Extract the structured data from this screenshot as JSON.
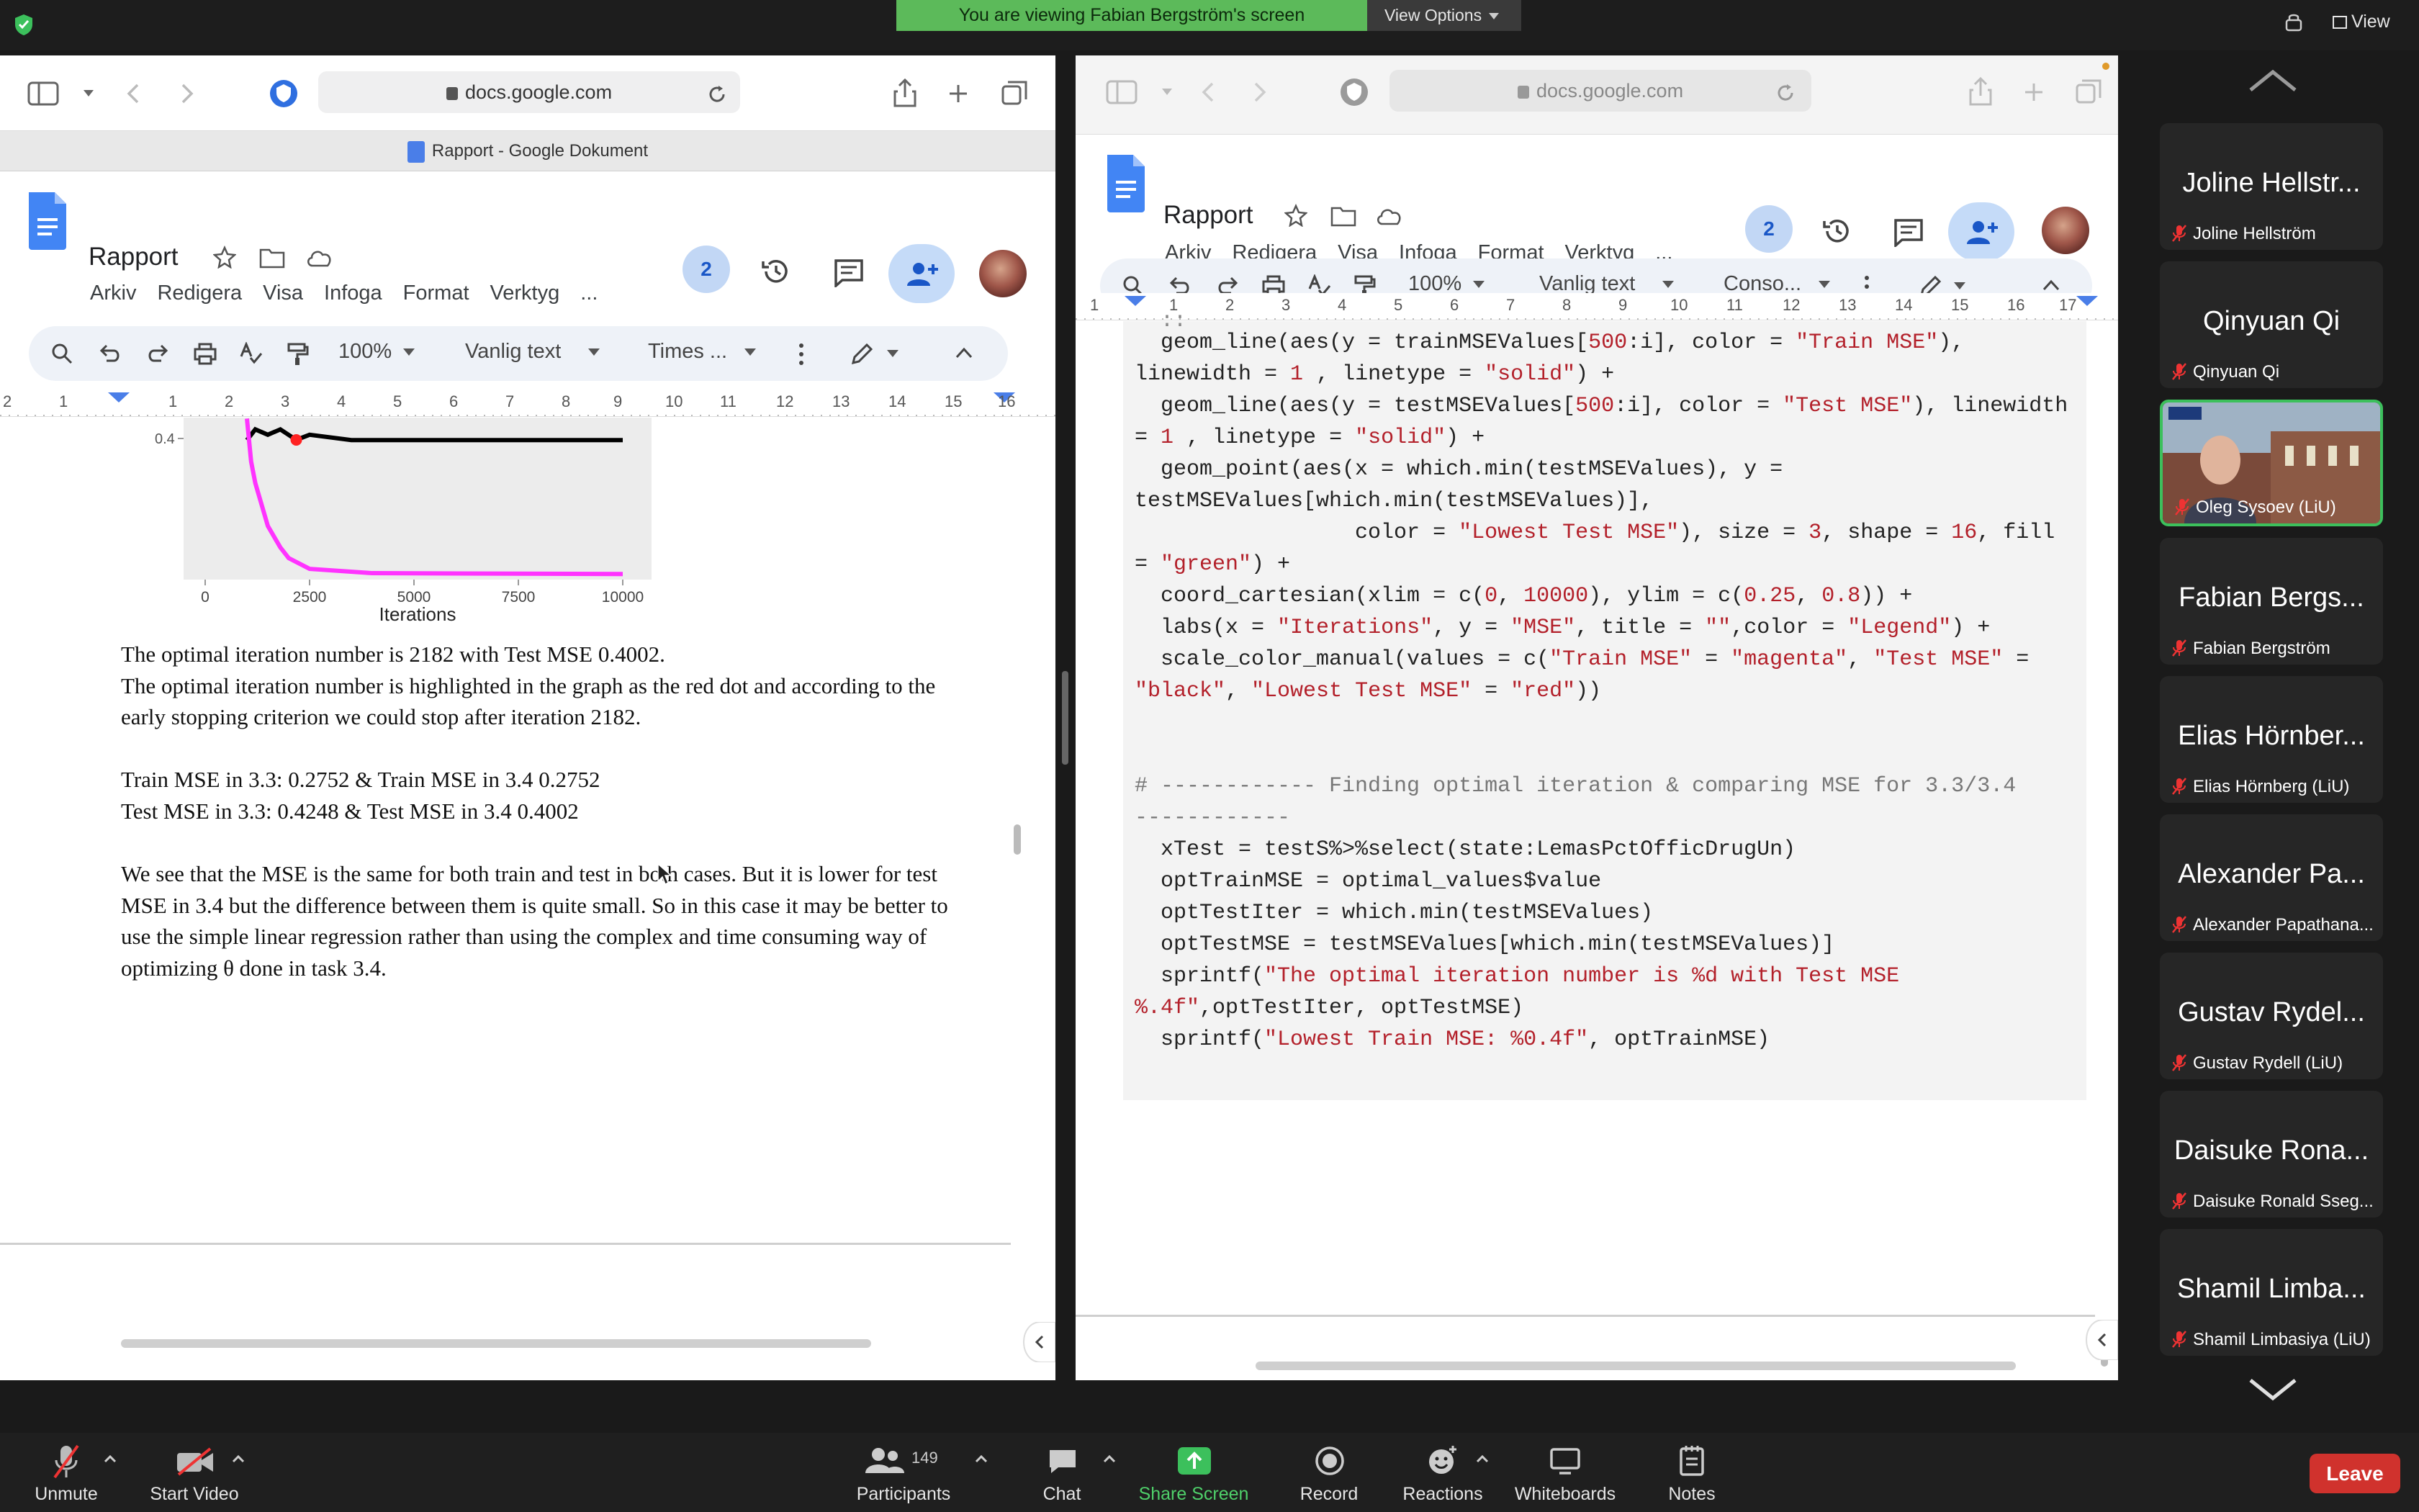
{
  "zoom_banner": {
    "text": "You are viewing Fabian Bergström's screen",
    "view_options": "View Options",
    "view_label": "View"
  },
  "left_browser": {
    "url": "docs.google.com",
    "tab_title": "Rapport - Google Dokument",
    "doc_title": "Rapport",
    "menus": [
      "Arkiv",
      "Redigera",
      "Visa",
      "Infoga",
      "Format",
      "Verktyg",
      "..."
    ],
    "badge": "2",
    "toolbar": {
      "zoom": "100%",
      "style": "Vanlig text",
      "font": "Times ..."
    },
    "ruler": [
      "2",
      "1",
      "1",
      "2",
      "3",
      "4",
      "5",
      "6",
      "7",
      "8",
      "9",
      "10",
      "11",
      "12",
      "13",
      "14",
      "15",
      "16"
    ],
    "chart": {
      "y_tick": "0.4",
      "x_ticks": [
        "0",
        "2500",
        "5000",
        "7500",
        "10000"
      ],
      "xlabel": "Iterations"
    },
    "paragraphs": [
      "The optimal iteration number is 2182 with Test MSE 0.4002.",
      "The optimal iteration number is highlighted in the graph as the red dot and according to the",
      "early stopping criterion we could stop after iteration 2182.",
      "Train MSE in 3.3: 0.2752 & Train MSE in 3.4 0.2752",
      "Test MSE in 3.3: 0.4248 & Test MSE in 3.4 0.4002",
      "We see that the MSE is the same for both train and test in both cases. But it is lower for test",
      "MSE in 3.4 but the difference between them is quite small. So in this case it may be better to",
      "use the simple linear regression rather than using the complex and time consuming way of",
      "optimizing θ done in task 3.4."
    ]
  },
  "right_browser": {
    "url": "docs.google.com",
    "doc_title": "Rapport",
    "menus": [
      "Arkiv",
      "Redigera",
      "Visa",
      "Infoga",
      "Format",
      "Verktyg",
      "..."
    ],
    "badge": "2",
    "toolbar": {
      "zoom": "100%",
      "style": "Vanlig text",
      "font": "Conso..."
    },
    "ruler": [
      "1",
      "1",
      "2",
      "3",
      "4",
      "5",
      "6",
      "7",
      "8",
      "9",
      "10",
      "11",
      "12",
      "13",
      "14",
      "15",
      "16",
      "17"
    ]
  },
  "chart_data": {
    "type": "line",
    "title": "",
    "xlabel": "Iterations",
    "ylabel": "",
    "x_ticks": [
      0,
      2500,
      5000,
      7500,
      10000
    ],
    "y_visible_tick": 0.4,
    "xlim": [
      0,
      10000
    ],
    "series": [
      {
        "color": "#000000",
        "x": [
          1000,
          1200,
          1500,
          1800,
          2182,
          2500,
          3500,
          10000
        ],
        "y": [
          0.4,
          0.41,
          0.405,
          0.41,
          0.4002,
          0.405,
          0.4,
          0.4
        ]
      },
      {
        "color": "#ff33ff",
        "x": [
          1000,
          1100,
          1200,
          1500,
          1800,
          2000,
          2500,
          4000,
          10000
        ],
        "y": [
          0.42,
          0.38,
          0.36,
          0.32,
          0.3,
          0.29,
          0.28,
          0.276,
          0.2752
        ]
      }
    ],
    "points": [
      {
        "x": 2182,
        "y": 0.4002,
        "color": "#ff2222"
      }
    ]
  },
  "participants": [
    {
      "big": "Joline Hellstr...",
      "small": "Joline Hellström",
      "video": false
    },
    {
      "big": "Qinyuan Qi",
      "small": "Qinyuan Qi",
      "video": false
    },
    {
      "big": "",
      "small": "Oleg Sysoev (LiU)",
      "video": true
    },
    {
      "big": "Fabian Bergs...",
      "small": "Fabian Bergström",
      "video": false
    },
    {
      "big": "Elias Hörnber...",
      "small": "Elias Hörnberg (LiU)",
      "video": false
    },
    {
      "big": "Alexander Pa...",
      "small": "Alexander Papathana...",
      "video": false
    },
    {
      "big": "Gustav Rydel...",
      "small": "Gustav Rydell (LiU)",
      "video": false
    },
    {
      "big": "Daisuke Rona...",
      "small": "Daisuke Ronald Sseg...",
      "video": false
    },
    {
      "big": "Shamil Limba...",
      "small": "Shamil Limbasiya (LiU)",
      "video": false
    }
  ],
  "bottom_bar": {
    "unmute": "Unmute",
    "start_video": "Start Video",
    "participants": "Participants",
    "participant_count": "149",
    "chat": "Chat",
    "share_screen": "Share Screen",
    "record": "Record",
    "reactions": "Reactions",
    "whiteboards": "Whiteboards",
    "notes": "Notes",
    "leave": "Leave"
  }
}
